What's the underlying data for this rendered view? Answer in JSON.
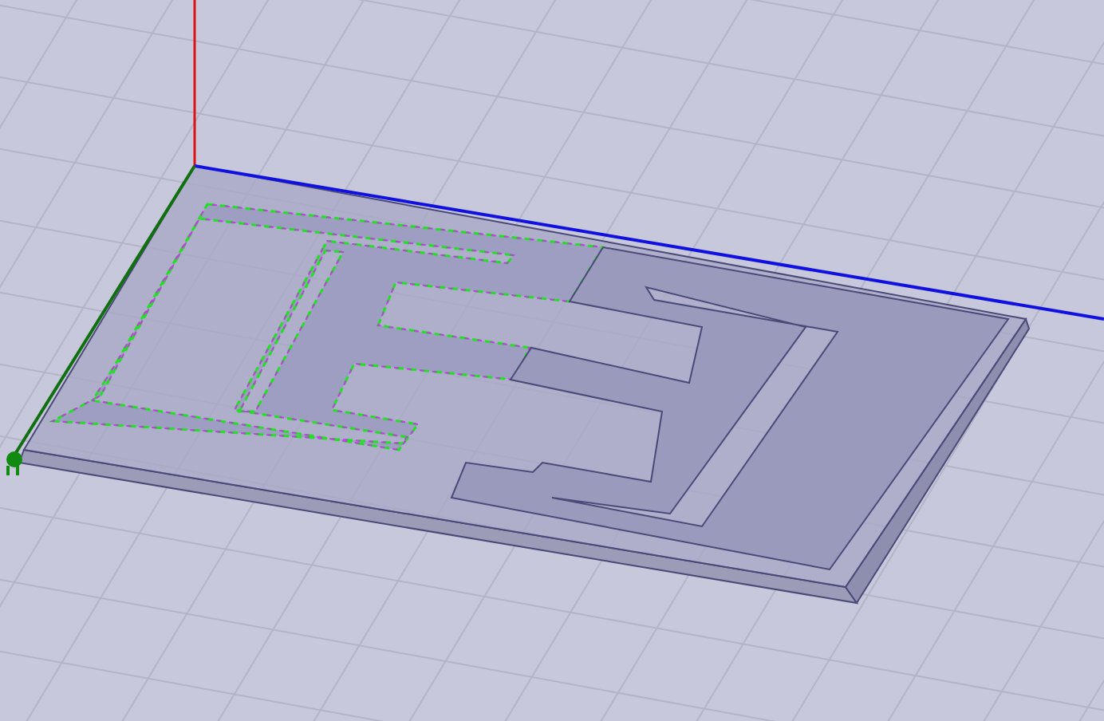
{
  "model": {
    "conductors": [
      {
        "kind": "comb",
        "selected": true
      },
      {
        "kind": "frame",
        "selected": false
      }
    ]
  }
}
